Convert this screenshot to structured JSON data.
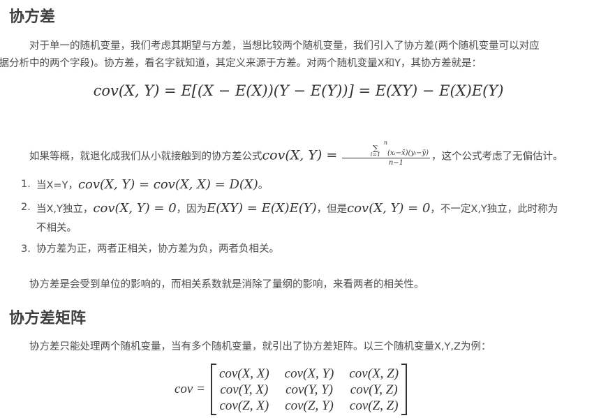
{
  "section1": {
    "heading": "协方差",
    "intro_line1": "对于单一的随机变量，我们考虑其期望与方差，当想比较两个随机变量，我们引入了协方差(两个随机变量可以对应",
    "intro_line2": "数据分析中的两个字段)。协方差，看名字就知道，其定义来源于方差。对两个随机变量X和Y，其协方差就是：",
    "definition_formula": "cov(X, Y) = E[(X − E(X))(Y − E(Y))] = E(XY) − E(X)E(Y)",
    "equal_prob_prefix": "如果等概，就退化成我们从小就接触到的协方差公式",
    "equal_prob_formula_lhs": "cov(X, Y) =",
    "equal_prob_fraction": {
      "sum_top": "n",
      "sum_symbol": "∑",
      "sum_bottom": "i=1",
      "numerator": "(xᵢ−x̄)(yᵢ−ȳ)",
      "denominator": "n−1"
    },
    "equal_prob_suffix": "，这个公式考虑了无偏估计。",
    "list": [
      {
        "number": "1.",
        "text_before": "当X=Y，",
        "formula": "cov(X, Y) = cov(X, X) = D(X)",
        "text_after": "。"
      },
      {
        "number": "2.",
        "text_before": "当X,Y独立，",
        "formula1": "cov(X, Y) = 0",
        "text_mid1": "，因为",
        "formula2": "E(XY) = E(X)E(Y)",
        "text_mid2": "，但是",
        "formula3": "cov(X, Y) = 0",
        "text_mid3": "，不一定X,Y独立，此时称为",
        "text_line2": "不相关。"
      },
      {
        "number": "3.",
        "text": "协方差为正，两者正相关，协方差为负，两者负相关。"
      }
    ],
    "note": "协方差是会受到单位的影响的，而相关系数就是消除了量纲的影响，来看两者的相关性。"
  },
  "section2": {
    "heading": "协方差矩阵",
    "intro": "协方差只能处理两个随机变量，当有多个随机变量，就引出了协方差矩阵。以三个随机变量X,Y,Z为例：",
    "matrix_lhs": "cov =",
    "matrix": [
      [
        "cov(X, X)",
        "cov(X, Y)",
        "cov(X, Z)"
      ],
      [
        "cov(Y, X)",
        "cov(Y, Y)",
        "cov(Y, Z)"
      ],
      [
        "cov(Z, X)",
        "cov(Z, Y)",
        "cov(Z, Z)"
      ]
    ]
  }
}
